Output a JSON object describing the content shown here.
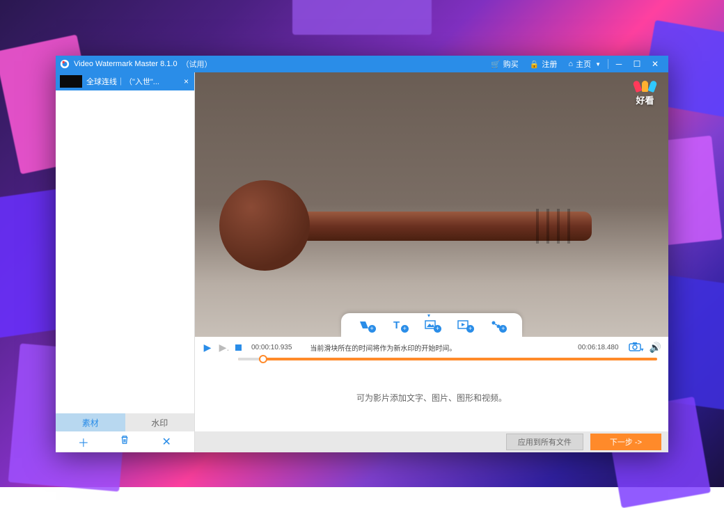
{
  "titlebar": {
    "app_name": "Video Watermark Master 8.1.0",
    "trial": "（试用）",
    "buy": "购买",
    "register": "注册",
    "home": "主页"
  },
  "sidebar": {
    "tab": {
      "label": "全球连线｜（\"入世\"..."
    },
    "tabs": {
      "material": "素材",
      "watermark": "水印"
    }
  },
  "video": {
    "watermark_brand": "好看",
    "tray_hint": "当前滑块所在的时间将作为新水印的开始时间。"
  },
  "timeline": {
    "current": "00:00:10.935",
    "total": "00:06:18.480"
  },
  "info": {
    "text": "可为影片添加文字、图片、图形和视频。"
  },
  "bottom": {
    "apply_all": "应用到所有文件",
    "next": "下一步 ->"
  },
  "colors": {
    "primary": "#2a8de8",
    "accent": "#ff8a2a"
  }
}
